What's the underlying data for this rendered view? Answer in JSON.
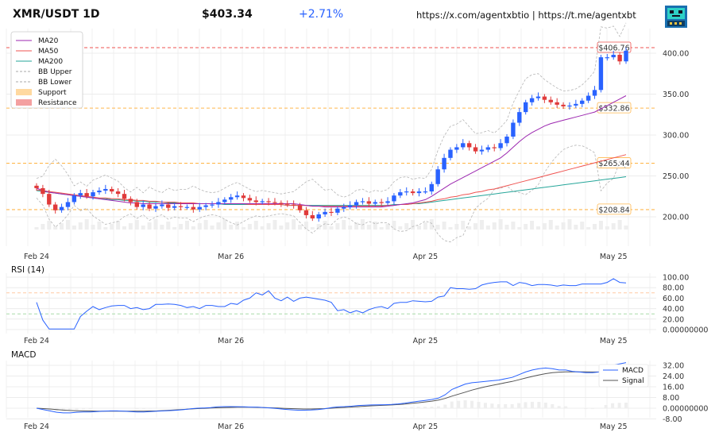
{
  "header": {
    "title": "XMR/USDT 1D",
    "price": "$403.34",
    "change": "+2.71%",
    "links": "https://x.com/agentxbtio | https://t.me/agentxbt",
    "logo_icon": "robot-monitor-icon"
  },
  "colors": {
    "up": "#2962ff",
    "down": "#e03a3a",
    "ma20": "#9c27b0",
    "ma50": "#ef5350",
    "ma200": "#26a69a",
    "support": "#ffb74d",
    "resistance": "#ef5350",
    "rsi": "#2962ff",
    "macd": "#2962ff",
    "signal": "#555555"
  },
  "chart_data": [
    {
      "type": "candlestick",
      "panel": "price",
      "x_labels": [
        "Feb 24",
        "Mar 26",
        "Apr 25",
        "May 25"
      ],
      "y_ticks": [
        "200.00",
        "250.00",
        "300.00",
        "350.00",
        "400.00"
      ],
      "ylim": [
        165,
        433
      ],
      "legend": [
        {
          "label": "MA20",
          "style": "line",
          "color": "#9c27b0"
        },
        {
          "label": "MA50",
          "style": "line",
          "color": "#ef5350"
        },
        {
          "label": "MA200",
          "style": "line",
          "color": "#26a69a"
        },
        {
          "label": "BB Upper",
          "style": "dash",
          "color": "#aaaaaa"
        },
        {
          "label": "BB Lower",
          "style": "dash",
          "color": "#aaaaaa"
        },
        {
          "label": "Support",
          "style": "patch",
          "color": "#ffd9a0"
        },
        {
          "label": "Resistance",
          "style": "patch",
          "color": "#f4a0a0"
        }
      ],
      "levels": [
        {
          "name": "Resistance",
          "value": 406.76,
          "label": "$406.76"
        },
        {
          "name": "Support",
          "value": 332.86,
          "label": "$332.86"
        },
        {
          "name": "Support",
          "value": 265.44,
          "label": "$265.44"
        },
        {
          "name": "Support",
          "value": 208.84,
          "label": "$208.84"
        }
      ],
      "closes": [
        235,
        228,
        215,
        208,
        212,
        218,
        226,
        229,
        225,
        230,
        232,
        234,
        231,
        228,
        222,
        218,
        212,
        215,
        210,
        213,
        215,
        211,
        213,
        212,
        212,
        209,
        212,
        214,
        215,
        218,
        221,
        224,
        226,
        223,
        220,
        218,
        219,
        218,
        217,
        216,
        215,
        214,
        208,
        202,
        198,
        203,
        206,
        205,
        210,
        212,
        214,
        218,
        219,
        216,
        218,
        217,
        219,
        226,
        230,
        231,
        229,
        231,
        231,
        240,
        258,
        272,
        282,
        285,
        290,
        285,
        280,
        282,
        285,
        284,
        290,
        298,
        315,
        328,
        340,
        345,
        347,
        343,
        340,
        337,
        335,
        336,
        338,
        342,
        348,
        355,
        395,
        395,
        398,
        390,
        403
      ],
      "ma20": [
        235,
        232,
        230,
        229,
        228,
        227,
        226,
        225,
        224,
        223,
        222,
        221,
        220,
        219,
        218,
        217,
        217,
        216,
        216,
        216,
        216,
        216,
        216,
        216,
        216,
        216,
        216,
        216,
        216,
        216,
        216,
        216,
        216,
        216,
        216,
        216,
        216,
        216,
        216,
        216,
        216,
        216,
        215,
        214,
        213,
        213,
        212,
        212,
        212,
        212,
        212,
        212,
        212,
        212,
        212,
        212,
        213,
        214,
        215,
        216,
        217,
        219,
        221,
        225,
        230,
        235,
        240,
        244,
        248,
        252,
        256,
        260,
        264,
        268,
        272,
        278,
        285,
        292,
        298,
        303,
        307,
        311,
        314,
        316,
        318,
        320,
        322,
        324,
        326,
        328,
        332,
        336,
        340,
        344,
        348
      ],
      "ma50": [
        233,
        232,
        231,
        230,
        229,
        228,
        227,
        226,
        225,
        224,
        223,
        223,
        222,
        222,
        221,
        221,
        220,
        220,
        219,
        219,
        218,
        218,
        218,
        217,
        217,
        217,
        216,
        216,
        216,
        216,
        216,
        216,
        216,
        216,
        215,
        215,
        215,
        215,
        215,
        215,
        214,
        214,
        214,
        214,
        213,
        213,
        213,
        213,
        213,
        213,
        213,
        213,
        213,
        213,
        213,
        213,
        214,
        214,
        215,
        215,
        216,
        217,
        218,
        219,
        221,
        222,
        224,
        225,
        227,
        228,
        230,
        231,
        233,
        234,
        236,
        238,
        240,
        242,
        244,
        246,
        248,
        250,
        252,
        254,
        256,
        258,
        260,
        262,
        264,
        266,
        268,
        270,
        272,
        274,
        276
      ],
      "ma200": [
        232,
        231,
        230,
        229,
        228,
        227,
        226,
        225,
        224,
        223,
        222,
        222,
        221,
        221,
        220,
        220,
        219,
        219,
        218,
        218,
        218,
        217,
        217,
        217,
        216,
        216,
        216,
        216,
        216,
        216,
        215,
        215,
        215,
        215,
        215,
        215,
        215,
        215,
        215,
        215,
        214,
        214,
        214,
        214,
        214,
        214,
        214,
        214,
        214,
        214,
        214,
        214,
        214,
        214,
        214,
        214,
        214,
        215,
        215,
        215,
        216,
        216,
        217,
        218,
        219,
        220,
        221,
        222,
        223,
        224,
        225,
        226,
        227,
        228,
        229,
        230,
        231,
        232,
        233,
        234,
        235,
        236,
        237,
        238,
        239,
        240,
        241,
        242,
        243,
        244,
        245,
        246,
        247,
        248,
        249
      ]
    },
    {
      "type": "line",
      "panel": "RSI (14)",
      "title": "RSI (14)",
      "x_labels": [
        "Feb 24",
        "Mar 26",
        "Apr 25",
        "May 25"
      ],
      "y_ticks": [
        "0.00000000",
        "20.00",
        "40.00",
        "60.00",
        "80.00",
        "100.00"
      ],
      "ylim": [
        -5,
        105
      ],
      "ref_lines": [
        70,
        30
      ],
      "values": [
        52,
        18,
        1,
        1,
        1,
        1,
        1,
        25,
        35,
        44,
        38,
        42,
        45,
        46,
        46,
        40,
        42,
        38,
        40,
        48,
        48,
        49,
        48,
        46,
        42,
        44,
        40,
        46,
        46,
        44,
        44,
        50,
        48,
        56,
        60,
        70,
        66,
        74,
        60,
        55,
        62,
        54,
        60,
        62,
        60,
        58,
        56,
        52,
        36,
        38,
        32,
        36,
        32,
        38,
        42,
        44,
        40,
        50,
        52,
        52,
        55,
        54,
        53,
        54,
        62,
        64,
        80,
        78,
        78,
        77,
        78,
        85,
        88,
        90,
        91,
        91,
        84,
        90,
        88,
        84,
        86,
        86,
        85,
        83,
        85,
        84,
        84,
        87,
        87,
        87,
        87,
        90,
        97,
        90,
        89
      ]
    },
    {
      "type": "line",
      "panel": "MACD",
      "title": "MACD",
      "x_labels": [
        "Feb 24",
        "Mar 26",
        "Apr 25",
        "May 25"
      ],
      "y_ticks": [
        "-8.00",
        "0.00000000",
        "8.00",
        "16.00",
        "24.00",
        "32.00"
      ],
      "ylim": [
        -10,
        36
      ],
      "series": [
        {
          "name": "MACD",
          "values": [
            0,
            -1,
            -2,
            -3,
            -3.5,
            -3.5,
            -3,
            -2.8,
            -2.8,
            -2.5,
            -2.2,
            -2,
            -2,
            -2.2,
            -2.5,
            -2.8,
            -2.8,
            -2.5,
            -2.2,
            -2,
            -1.8,
            -1.5,
            -1,
            -0.5,
            0,
            0.2,
            0.5,
            1,
            1.2,
            1.2,
            1.1,
            1,
            0.8,
            0.8,
            0.5,
            0.2,
            -0.3,
            -0.8,
            -1.2,
            -1.5,
            -1.5,
            -1.3,
            -1,
            -0.5,
            0.5,
            1,
            1.2,
            1.5,
            2,
            2.2,
            2.4,
            2.5,
            2.6,
            2.8,
            3.2,
            3.8,
            4.5,
            5.2,
            5.8,
            6.5,
            7.5,
            10,
            14,
            16,
            18,
            19,
            19.5,
            20,
            20.5,
            21,
            22,
            23,
            25,
            27,
            28.5,
            29.5,
            30,
            29.5,
            28.5,
            28.5,
            27.5,
            27,
            26.5,
            26.5,
            27,
            30,
            32,
            33,
            34
          ]
        },
        {
          "name": "Signal",
          "values": [
            0,
            -0.3,
            -0.6,
            -1,
            -1.4,
            -1.7,
            -1.9,
            -2,
            -2.1,
            -2.2,
            -2.2,
            -2.2,
            -2.2,
            -2.2,
            -2.2,
            -2.2,
            -2.2,
            -2.1,
            -2,
            -1.8,
            -1.5,
            -1.2,
            -0.9,
            -0.6,
            -0.3,
            -0.1,
            0.1,
            0.3,
            0.5,
            0.6,
            0.7,
            0.7,
            0.7,
            0.6,
            0.5,
            0.3,
            0.1,
            -0.1,
            -0.3,
            -0.5,
            -0.6,
            -0.6,
            -0.5,
            -0.3,
            0,
            0.3,
            0.6,
            0.9,
            1.2,
            1.5,
            1.8,
            2,
            2.2,
            2.4,
            2.7,
            3.1,
            3.6,
            4.1,
            4.7,
            5.3,
            6.1,
            7.3,
            9,
            10.5,
            12,
            13.5,
            14.8,
            16,
            17,
            18,
            19,
            20,
            21.2,
            22.5,
            23.7,
            24.8,
            25.8,
            26.5,
            26.9,
            27.1,
            27.2,
            27.1,
            27.1,
            27,
            27.1,
            27.6,
            28.3,
            29,
            29.8
          ]
        }
      ]
    }
  ]
}
